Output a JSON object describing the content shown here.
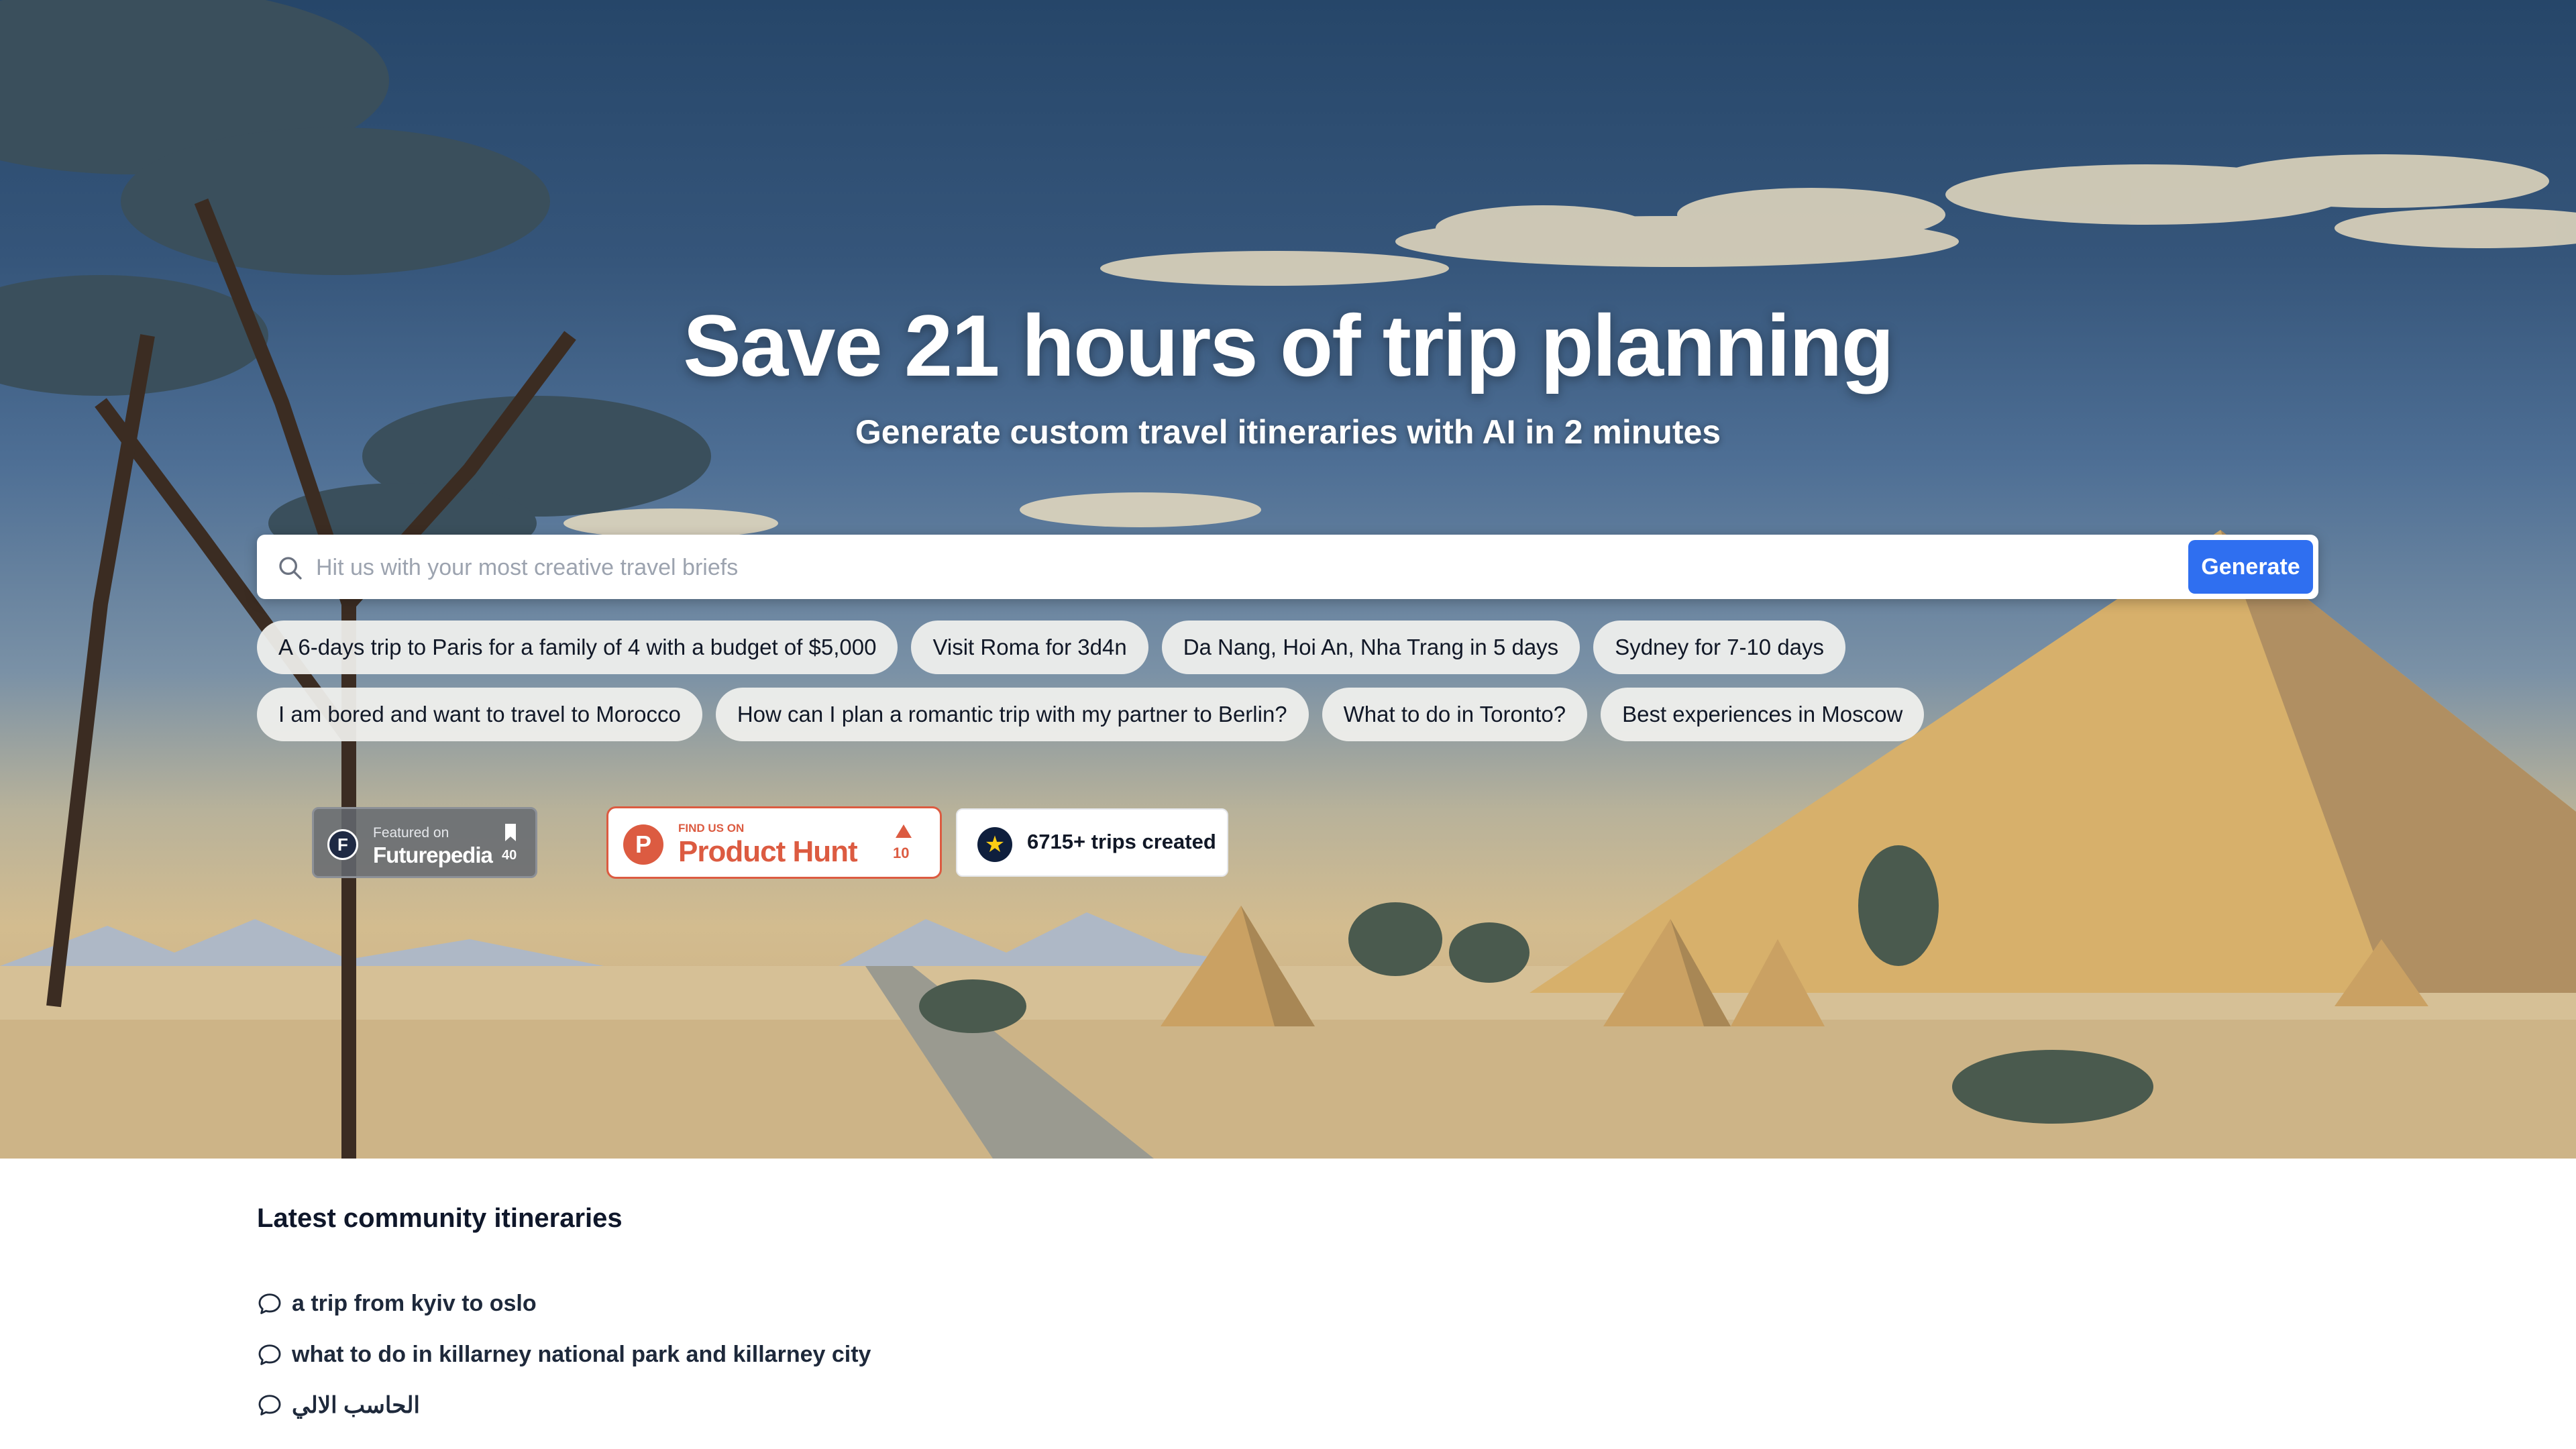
{
  "hero": {
    "title": "Save 21 hours of trip planning",
    "subtitle": "Generate custom travel itineraries with AI in 2 minutes"
  },
  "search": {
    "placeholder": "Hit us with your most creative travel briefs",
    "value": "",
    "button_label": "Generate",
    "icon": "search-icon"
  },
  "suggestions": {
    "row1": [
      "A 6-days trip to Paris for a family of 4 with a budget of $5,000",
      "Visit Roma for 3d4n",
      "Da Nang, Hoi An, Nha Trang in 5 days",
      "Sydney for 7-10 days"
    ],
    "row2": [
      "I am bored and want to travel to Morocco",
      "How can I plan a romantic trip with my partner to Berlin?",
      "What to do in Toronto?",
      "Best experiences in Moscow"
    ]
  },
  "badges": {
    "futurepedia": {
      "small": "Featured on",
      "name": "Futurepedia",
      "count": "40",
      "logo_letter": "F"
    },
    "producthunt": {
      "small": "FIND US ON",
      "name": "Product Hunt",
      "count": "10",
      "logo_letter": "P"
    },
    "trips": {
      "text": "6715+ trips created",
      "icon": "star-icon"
    }
  },
  "community": {
    "title": "Latest community itineraries",
    "items": [
      "a trip from kyiv to oslo",
      "what to do in killarney national park and killarney city",
      "الحاسب الالي"
    ]
  },
  "colors": {
    "accent": "#2f6ff0",
    "producthunt": "#dc5b41",
    "text_dark": "#0f172a"
  }
}
